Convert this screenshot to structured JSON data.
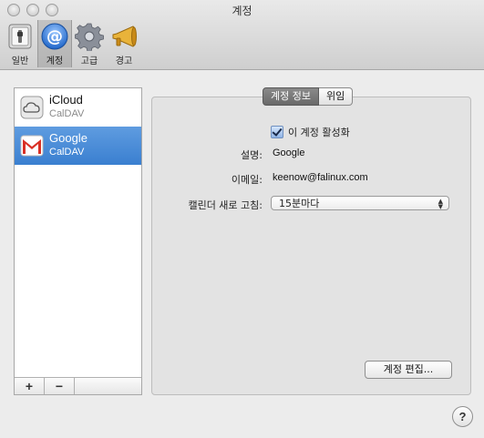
{
  "window": {
    "title": "계정"
  },
  "toolbar": {
    "items": [
      {
        "label": "일반",
        "icon": "switch-icon"
      },
      {
        "label": "계정",
        "icon": "at-sign-icon"
      },
      {
        "label": "고급",
        "icon": "gear-icon"
      },
      {
        "label": "경고",
        "icon": "megaphone-icon"
      }
    ],
    "selected": "계정"
  },
  "sidebar": {
    "accounts": [
      {
        "name": "iCloud",
        "type": "CalDAV",
        "icon": "icloud-icon"
      },
      {
        "name": "Google",
        "type": "CalDAV",
        "icon": "gmail-icon"
      }
    ],
    "selected": "Google",
    "add_label": "+",
    "remove_label": "−"
  },
  "tabs": [
    {
      "label": "계정 정보"
    },
    {
      "label": "위임"
    }
  ],
  "selected_tab": "계정 정보",
  "form": {
    "enable_label": "이 계정 활성화",
    "enabled": true,
    "description_label": "설명:",
    "description_value": "Google",
    "email_label": "이메일:",
    "email_value": "keenow@falinux.com",
    "refresh_label": "캘린더 새로 고침:",
    "refresh_value": "15분마다"
  },
  "buttons": {
    "edit_account": "계정 편집...",
    "help": "?"
  },
  "colors": {
    "selection": "#3a7fd0",
    "panel": "#e3e3e3",
    "window": "#ececec"
  }
}
